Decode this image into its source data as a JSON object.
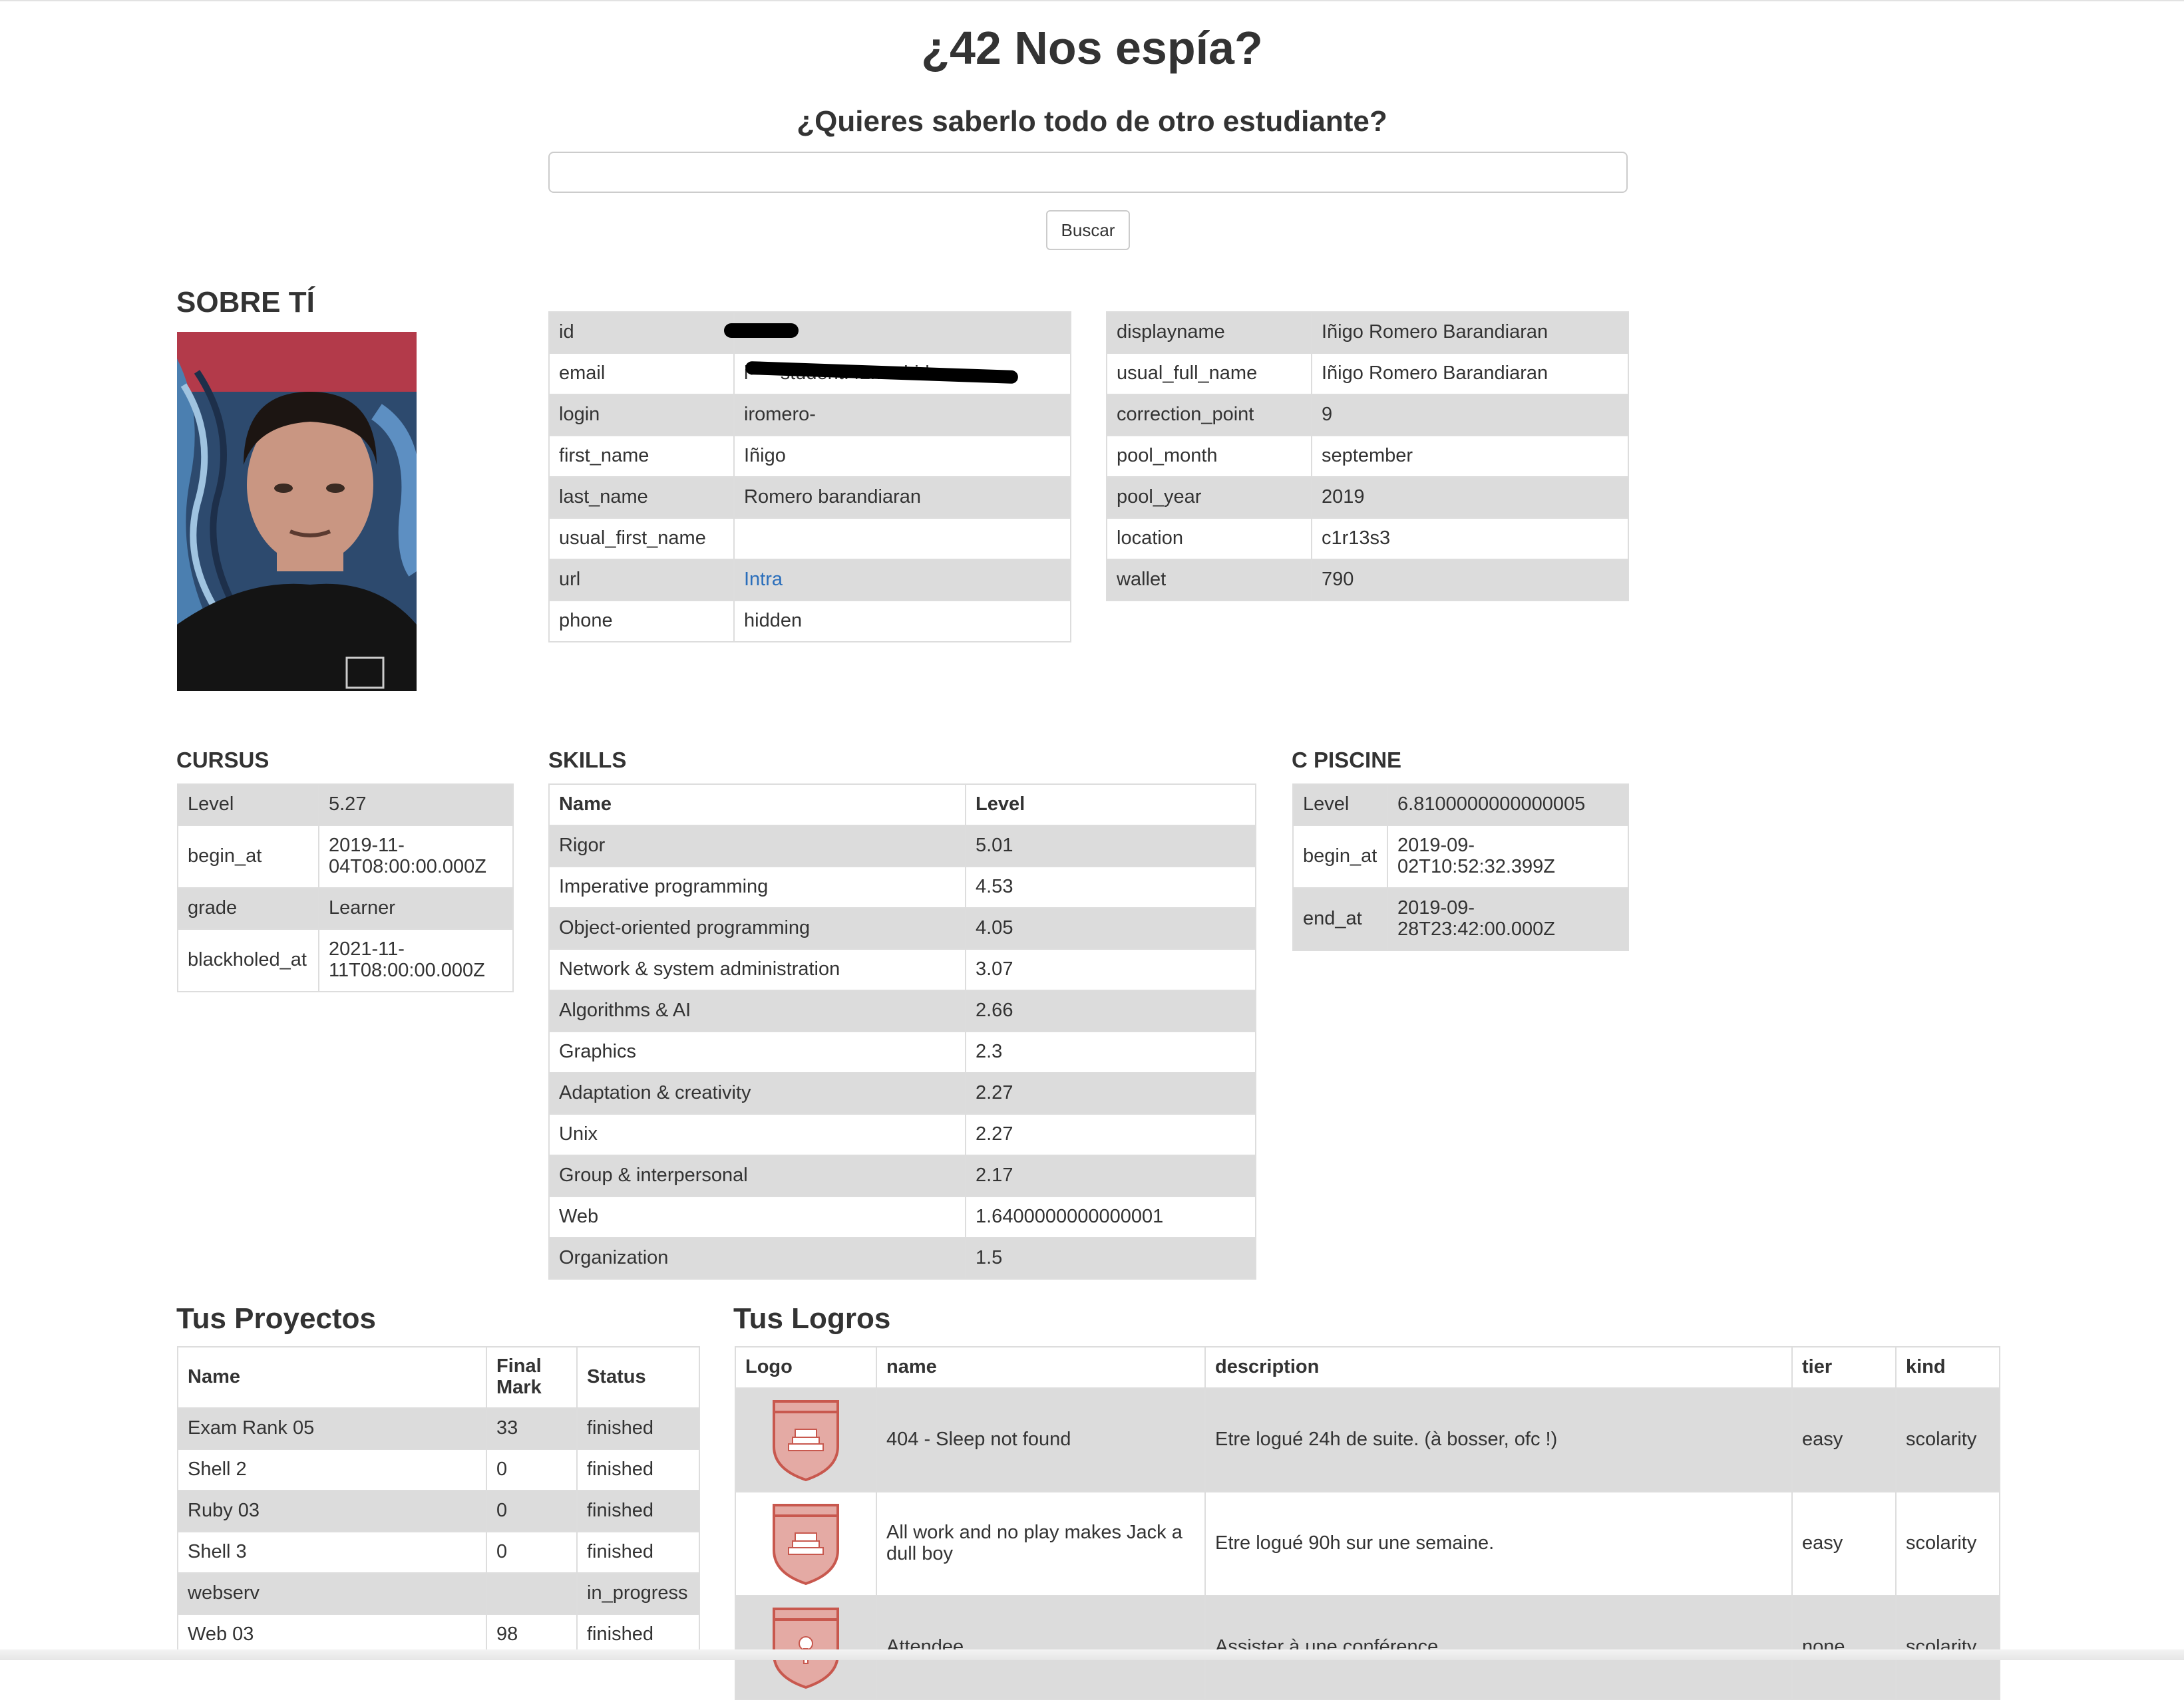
{
  "header": {
    "title": "¿42 Nos espía?",
    "subtitle": "¿Quieres saberlo todo de otro estudiante?",
    "search_value": "",
    "search_button": "Buscar"
  },
  "about": {
    "heading": "SOBRE TÍ",
    "table1": [
      {
        "key": "id",
        "value": ""
      },
      {
        "key": "email",
        "value": "i·····student.42madrid.com"
      },
      {
        "key": "login",
        "value": "iromero-"
      },
      {
        "key": "first_name",
        "value": "Iñigo"
      },
      {
        "key": "last_name",
        "value": "Romero barandiaran"
      },
      {
        "key": "usual_first_name",
        "value": ""
      },
      {
        "key": "url",
        "value": "Intra"
      },
      {
        "key": "phone",
        "value": "hidden"
      }
    ],
    "table2": [
      {
        "key": "displayname",
        "value": "Iñigo Romero Barandiaran"
      },
      {
        "key": "usual_full_name",
        "value": "Iñigo Romero Barandiaran"
      },
      {
        "key": "correction_point",
        "value": "9"
      },
      {
        "key": "pool_month",
        "value": "september"
      },
      {
        "key": "pool_year",
        "value": "2019"
      },
      {
        "key": "location",
        "value": "c1r13s3"
      },
      {
        "key": "wallet",
        "value": "790"
      }
    ]
  },
  "cursus": {
    "heading": "CURSUS",
    "rows": [
      {
        "key": "Level",
        "value": "5.27"
      },
      {
        "key": "begin_at",
        "value": "2019-11-04T08:00:00.000Z"
      },
      {
        "key": "grade",
        "value": "Learner"
      },
      {
        "key": "blackholed_at",
        "value": "2021-11-11T08:00:00.000Z"
      }
    ]
  },
  "skills": {
    "heading": "SKILLS",
    "col_name": "Name",
    "col_level": "Level",
    "rows": [
      {
        "name": "Rigor",
        "level": "5.01"
      },
      {
        "name": "Imperative programming",
        "level": "4.53"
      },
      {
        "name": "Object-oriented programming",
        "level": "4.05"
      },
      {
        "name": "Network & system administration",
        "level": "3.07"
      },
      {
        "name": "Algorithms & AI",
        "level": "2.66"
      },
      {
        "name": "Graphics",
        "level": "2.3"
      },
      {
        "name": "Adaptation & creativity",
        "level": "2.27"
      },
      {
        "name": "Unix",
        "level": "2.27"
      },
      {
        "name": "Group & interpersonal",
        "level": "2.17"
      },
      {
        "name": "Web",
        "level": "1.6400000000000001"
      },
      {
        "name": "Organization",
        "level": "1.5"
      }
    ]
  },
  "piscine": {
    "heading": "C PISCINE",
    "rows": [
      {
        "key": "Level",
        "value": "6.8100000000000005"
      },
      {
        "key": "begin_at",
        "value": "2019-09-02T10:52:32.399Z"
      },
      {
        "key": "end_at",
        "value": "2019-09-28T23:42:00.000Z"
      }
    ]
  },
  "projects": {
    "heading": "Tus Proyectos",
    "col_name": "Name",
    "col_mark": "Final Mark",
    "col_status": "Status",
    "rows": [
      {
        "name": "Exam Rank 05",
        "mark": "33",
        "status": "finished"
      },
      {
        "name": "Shell 2",
        "mark": "0",
        "status": "finished"
      },
      {
        "name": "Ruby 03",
        "mark": "0",
        "status": "finished"
      },
      {
        "name": "Shell 3",
        "mark": "0",
        "status": "finished"
      },
      {
        "name": "webserv",
        "mark": "",
        "status": "in_progress"
      },
      {
        "name": "Web 03",
        "mark": "98",
        "status": "finished"
      }
    ]
  },
  "achievements": {
    "heading": "Tus Logros",
    "col_logo": "Logo",
    "col_name": "name",
    "col_description": "description",
    "col_tier": "tier",
    "col_kind": "kind",
    "rows": [
      {
        "logo": "stacked-pages-shield-icon",
        "name": "404 - Sleep not found",
        "description": "Etre logué 24h de suite. (à bosser, ofc !)",
        "tier": "easy",
        "kind": "scolarity"
      },
      {
        "logo": "stacked-pages-shield-icon",
        "name": "All work and no play makes Jack a dull boy",
        "description": "Etre logué 90h sur une semaine.",
        "tier": "easy",
        "kind": "scolarity"
      },
      {
        "logo": "microphone-shield-icon",
        "name": "Attendee",
        "description": "Assister à une conférence.",
        "tier": "none",
        "kind": "scolarity"
      }
    ],
    "badge_color": "#e4aaa4",
    "badge_stroke": "#c8584e"
  },
  "colors": {
    "stripe": "#dcdcdc",
    "border": "#dddddd",
    "link": "#2a6ebb",
    "text": "#333333"
  }
}
